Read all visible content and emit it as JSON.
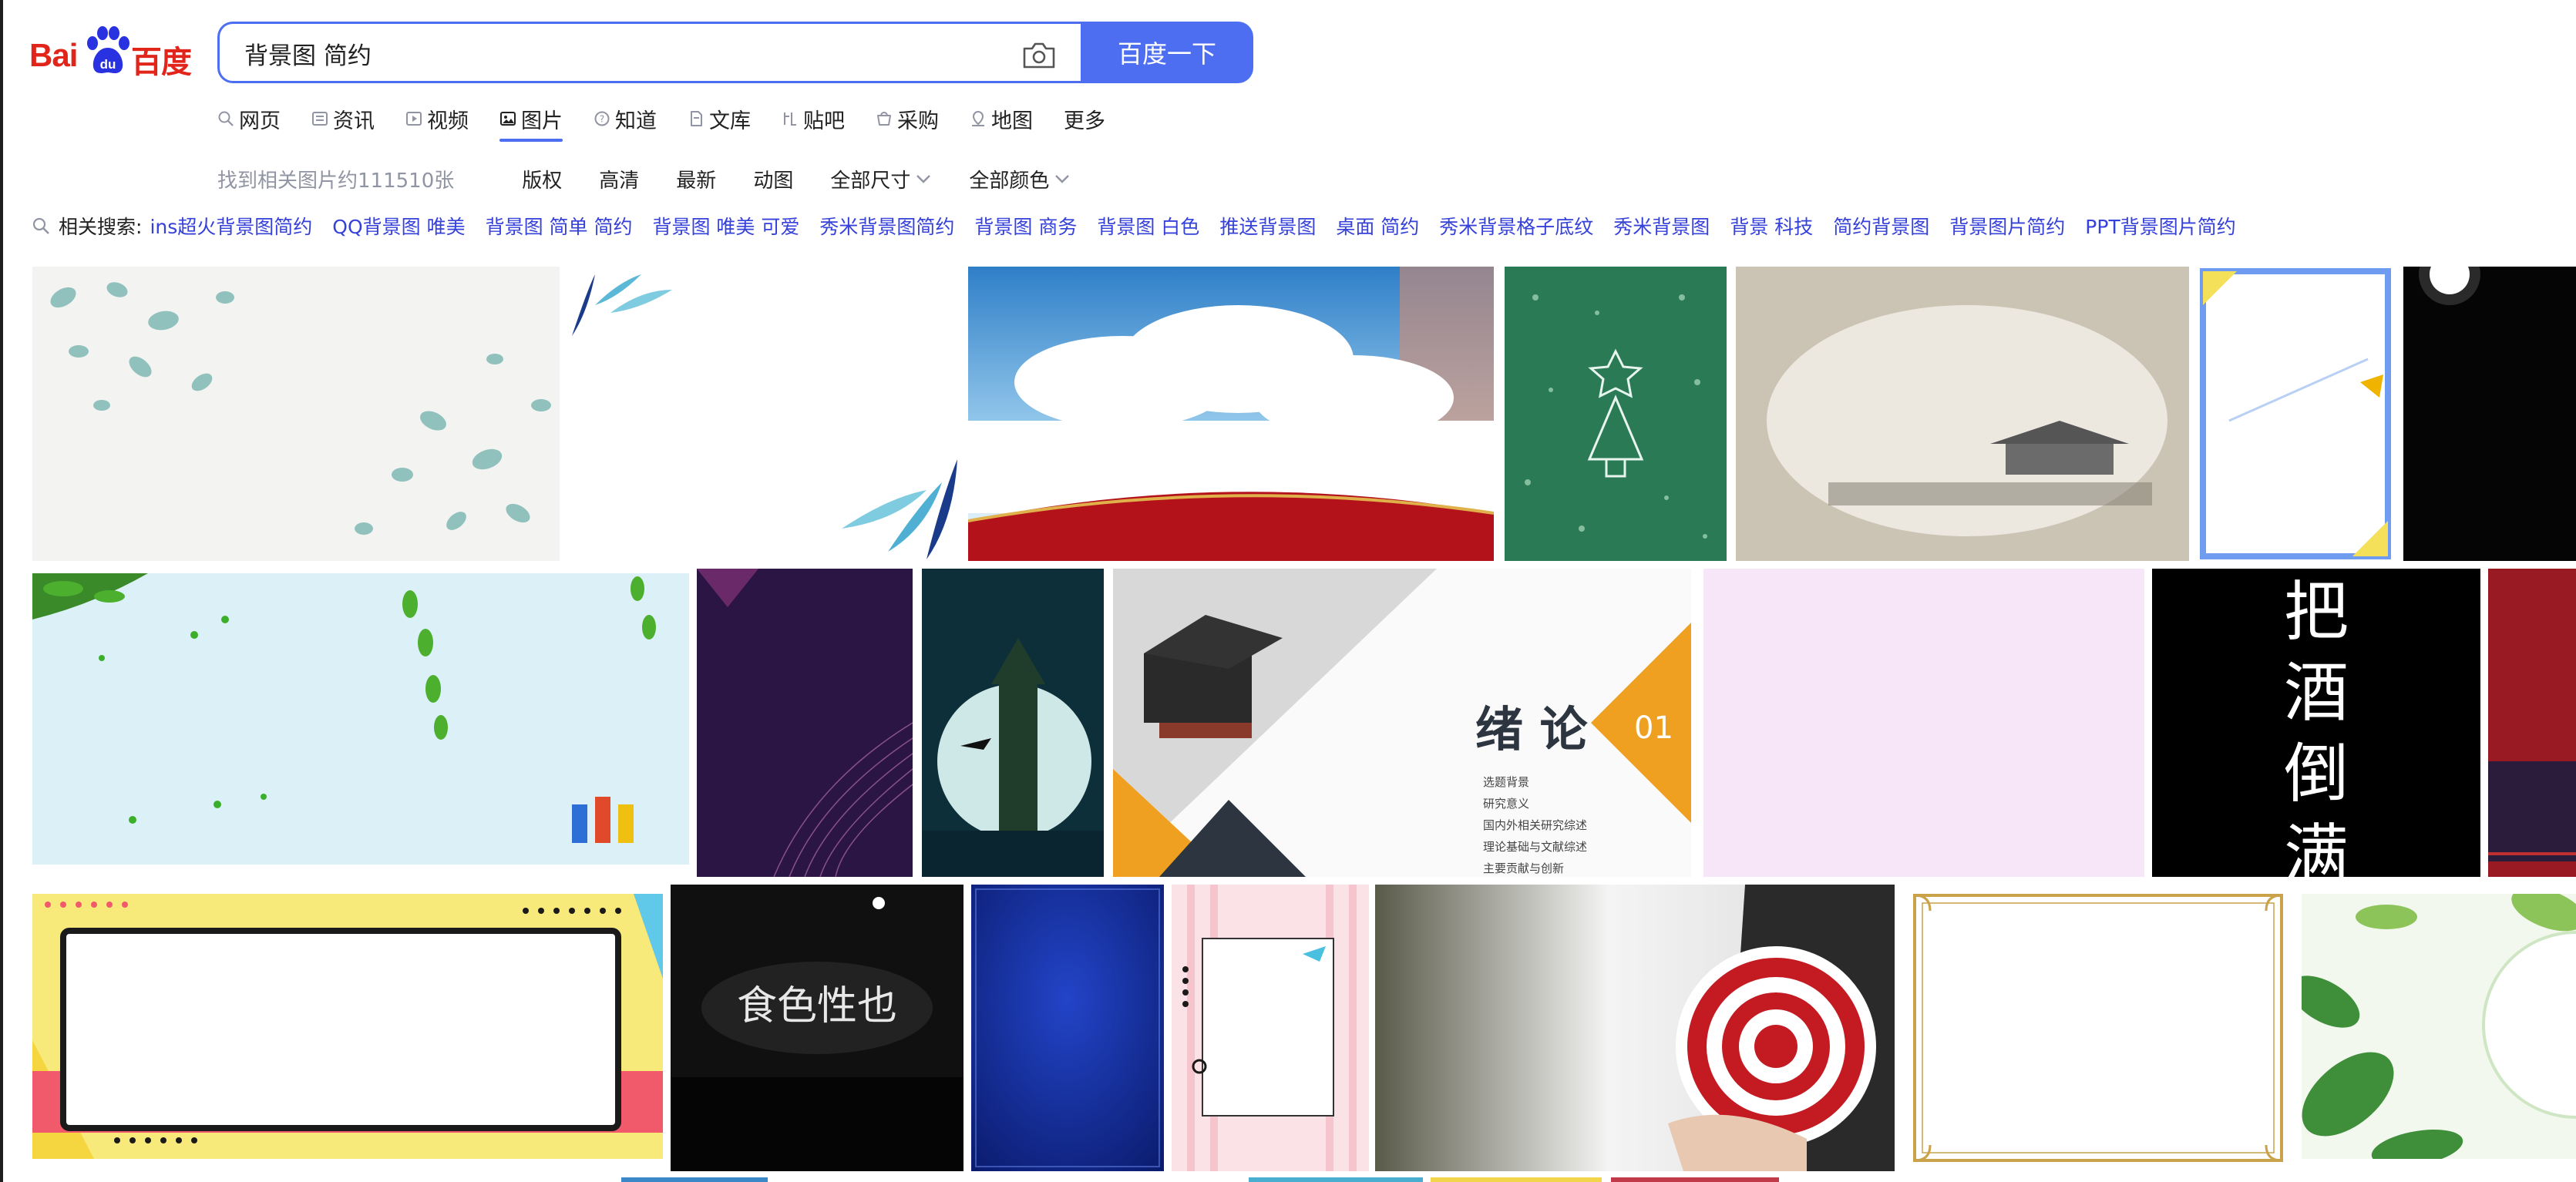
{
  "logo": {
    "part1": "Bai",
    "part2": "百度",
    "paw_text": "du"
  },
  "search": {
    "query": "背景图 简约",
    "button_label": "百度一下"
  },
  "nav": {
    "items": [
      {
        "label": "网页",
        "icon": "search-icon"
      },
      {
        "label": "资讯",
        "icon": "news-icon"
      },
      {
        "label": "视频",
        "icon": "video-icon"
      },
      {
        "label": "图片",
        "icon": "image-icon",
        "active": true
      },
      {
        "label": "知道",
        "icon": "question-icon"
      },
      {
        "label": "文库",
        "icon": "document-icon"
      },
      {
        "label": "贴吧",
        "icon": "tieba-icon"
      },
      {
        "label": "采购",
        "icon": "shopping-icon"
      },
      {
        "label": "地图",
        "icon": "map-icon"
      },
      {
        "label": "更多",
        "icon": ""
      }
    ]
  },
  "filters": {
    "result_count": "找到相关图片约111510张",
    "items": [
      {
        "label": "版权"
      },
      {
        "label": "高清"
      },
      {
        "label": "最新"
      },
      {
        "label": "动图"
      },
      {
        "label": "全部尺寸",
        "dropdown": true
      },
      {
        "label": "全部颜色",
        "dropdown": true
      }
    ]
  },
  "related": {
    "label": "相关搜索:",
    "links": [
      "ins超火背景图简约",
      "QQ背景图 唯美",
      "背景图 简单 简约",
      "背景图 唯美 可爱",
      "秀米背景图简约",
      "背景图 商务",
      "背景图 白色",
      "推送背景图",
      "桌面 简约",
      "秀米背景格子底纹",
      "秀米背景图",
      "背景 科技",
      "简约背景图",
      "背景图片简约",
      "PPT背景图片简约"
    ]
  },
  "thumbs": {
    "title_card": {
      "heading": "绪 论",
      "number": "01",
      "bullets": [
        "选题背景",
        "研究意义",
        "国内外相关研究综述",
        "理论基础与文献综述",
        "主要贡献与创新"
      ]
    },
    "calligraphy": {
      "chars": [
        "把",
        "酒",
        "倒",
        "满"
      ]
    },
    "neon": {
      "text": "食色性也"
    }
  },
  "colors": {
    "accent": "#4e6ef2",
    "brand_red": "#e1251b",
    "link": "#3641d9",
    "muted": "#9195a3"
  }
}
